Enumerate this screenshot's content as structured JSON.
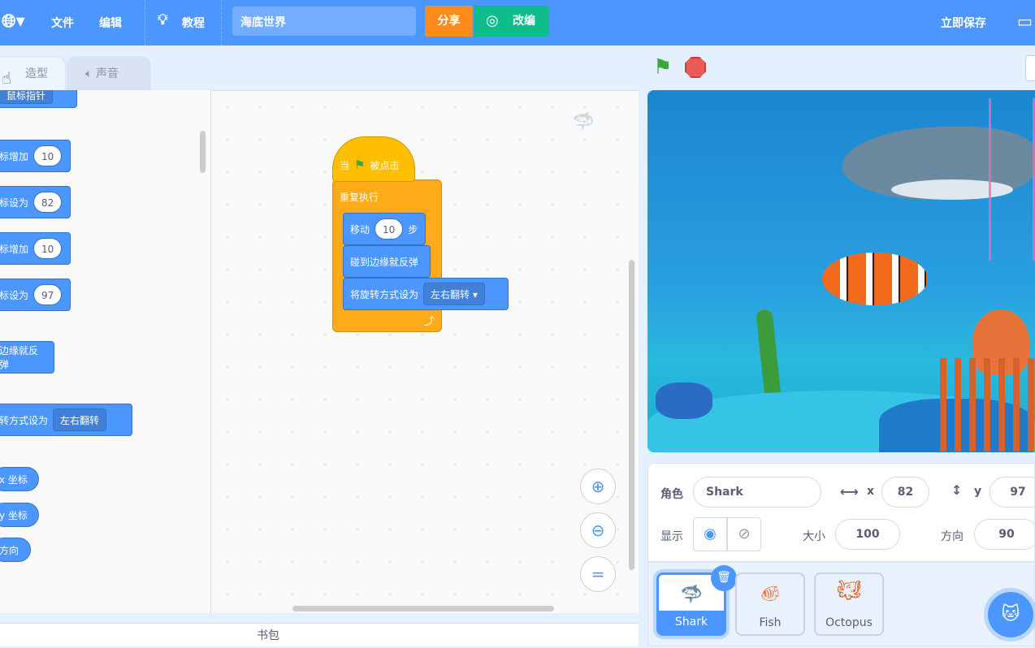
{
  "menu": {
    "file": "文件",
    "edit": "编辑",
    "tutorial": "教程",
    "project_title": "海底世界",
    "share": "分享",
    "remix": "改编",
    "save_now": "立即保存"
  },
  "tabs": {
    "costumes": "造型",
    "sounds": "声音"
  },
  "palette": {
    "blocks": [
      {
        "text": "鼠标指针",
        "type": "dropdown"
      },
      {
        "text": "标增加",
        "value": "10"
      },
      {
        "text": "标设为",
        "value": "82"
      },
      {
        "text": "标增加",
        "value": "10"
      },
      {
        "text": "标设为",
        "value": "97"
      },
      {
        "text": "边缘就反弹"
      },
      {
        "text": "转方式设为",
        "dropdown": "左右翻转"
      },
      {
        "text": "x 坐标"
      },
      {
        "text": "y 坐标"
      },
      {
        "text": "方向"
      }
    ]
  },
  "script": {
    "hat": {
      "pre": "当",
      "post": "被点击"
    },
    "forever": "重复执行",
    "move": {
      "pre": "移动",
      "value": "10",
      "post": "步"
    },
    "bounce": "碰到边缘就反弹",
    "rotation": {
      "label": "将旋转方式设为",
      "value": "左右翻转"
    }
  },
  "backpack": "书包",
  "sprite_info": {
    "sprite_label": "角色",
    "sprite_name": "Shark",
    "x_label": "x",
    "x": "82",
    "y_label": "y",
    "y": "97",
    "show_label": "显示",
    "size_label": "大小",
    "size": "100",
    "direction_label": "方向",
    "direction": "90"
  },
  "sprites": [
    {
      "name": "Shark",
      "selected": true
    },
    {
      "name": "Fish"
    },
    {
      "name": "Octopus"
    }
  ],
  "colors": {
    "accent": "#4c97ff",
    "share": "#ff8c1a",
    "remix": "#0fbd8c",
    "events": "#ffbf00",
    "control": "#ffab19"
  }
}
